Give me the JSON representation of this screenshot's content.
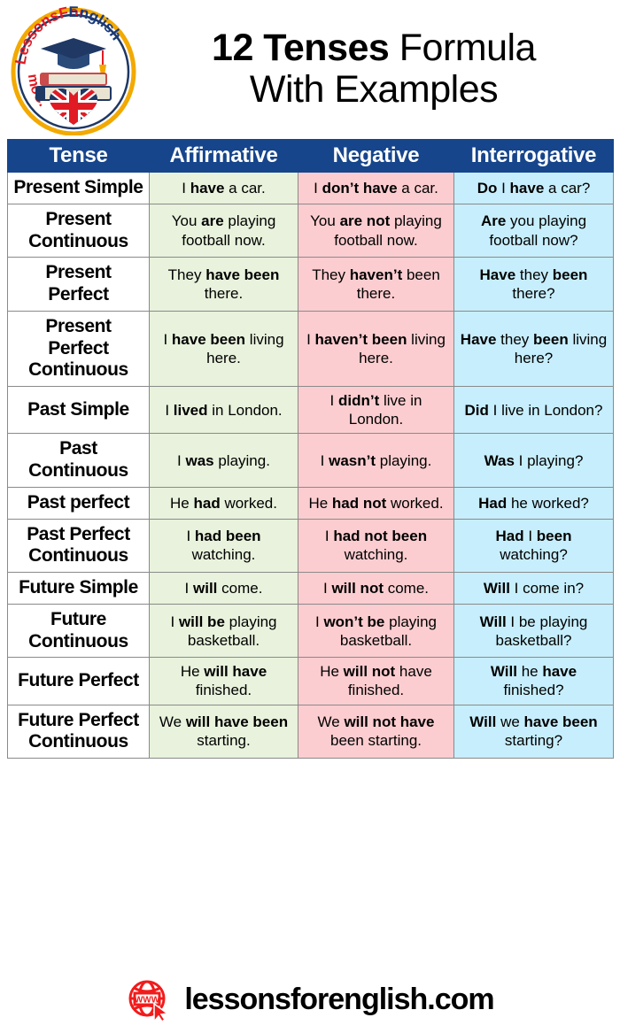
{
  "header": {
    "logo": {
      "name": "lessonsforenglish-logo",
      "alt_text": "LessonsForEnglish.Com",
      "ring_text_left": "LessonsFor",
      "ring_text_right": "English.Com",
      "colors": {
        "ring_gold": "#f2a900",
        "red_text": "#e01b24",
        "blue_text": "#1a3a7a",
        "cap_navy": "#1f3864"
      }
    },
    "title_line_1_strong": "12 Tenses",
    "title_line_1_light": " Formula",
    "title_line_2": "With Examples"
  },
  "table": {
    "columns": [
      "Tense",
      "Affirmative",
      "Negative",
      "Interrogative"
    ],
    "colors": {
      "header_bg": "#16458c",
      "header_fg": "#ffffff",
      "affirmative_bg": "#e8f2dc",
      "negative_bg": "#fccdd0",
      "interrogative_bg": "#c7eefc",
      "tense_bg": "#ffffff",
      "grid_line": "#8a8a8a"
    },
    "rows": [
      {
        "tense": "Present Simple",
        "affirmative": "I <b>have</b> a car.",
        "negative": "I <b>don&rsquo;t have</b> a car.",
        "interrogative": "<b>Do</b> I <b>have</b> a car?"
      },
      {
        "tense": "Present Continuous",
        "affirmative": "You <b>are</b> playing football now.",
        "negative": "You <b>are not</b> playing football now.",
        "interrogative": "<b>Are</b> you playing football now?"
      },
      {
        "tense": "Present Perfect",
        "affirmative": "They <b>have been</b> there.",
        "negative": "They <b>haven&rsquo;t</b> been there.",
        "interrogative": "<b>Have</b> they <b>been</b> there?"
      },
      {
        "tense": "Present Perfect Continuous",
        "affirmative": "I <b>have been</b> living here.",
        "negative": "I <b>haven&rsquo;t been</b> living here.",
        "interrogative": "<b>Have</b> they <b>been</b> living here?"
      },
      {
        "tense": "Past Simple",
        "affirmative": "I <b>lived</b> in London.",
        "negative": "I <b>didn&rsquo;t</b> live in London.",
        "interrogative": "<b>Did</b> I live in London?"
      },
      {
        "tense": "Past Continuous",
        "affirmative": "I <b>was</b> playing.",
        "negative": "I <b>wasn&rsquo;t</b> playing.",
        "interrogative": "<b>Was</b> I playing?"
      },
      {
        "tense": "Past perfect",
        "affirmative": "He <b>had</b> worked.",
        "negative": "He <b>had not</b> worked.",
        "interrogative": "<b>Had</b> he worked?"
      },
      {
        "tense": "Past Perfect Continuous",
        "affirmative": "I <b>had been</b> watching.",
        "negative": "I <b>had not been</b> watching.",
        "interrogative": "<b>Had</b> I <b>been</b> watching?"
      },
      {
        "tense": "Future Simple",
        "affirmative": "I <b>will</b> come.",
        "negative": "I <b>will not</b> come.",
        "interrogative": "<b>Will</b> I come in?"
      },
      {
        "tense": "Future Continuous",
        "affirmative": "I <b>will be</b> playing basketball.",
        "negative": "I <b>won&rsquo;t be</b> playing basketball.",
        "interrogative": "<b>Will</b> I be playing basketball?"
      },
      {
        "tense": "Future Perfect",
        "affirmative": "He <b>will have</b> finished.",
        "negative": "He <b>will not</b> have finished.",
        "interrogative": "<b>Will</b> he <b>have</b> finished?"
      },
      {
        "tense": "Future Perfect Continuous",
        "affirmative": "We <b>will have been</b> starting.",
        "negative": "We <b>will not have</b> been starting.",
        "interrogative": "<b>Will</b> we <b>have been</b> starting?"
      }
    ]
  },
  "footer": {
    "icon_name": "www-globe-cursor-icon",
    "icon_label": "WWW",
    "icon_color": "#f21b1b",
    "site": "lessonsforenglish.com"
  }
}
